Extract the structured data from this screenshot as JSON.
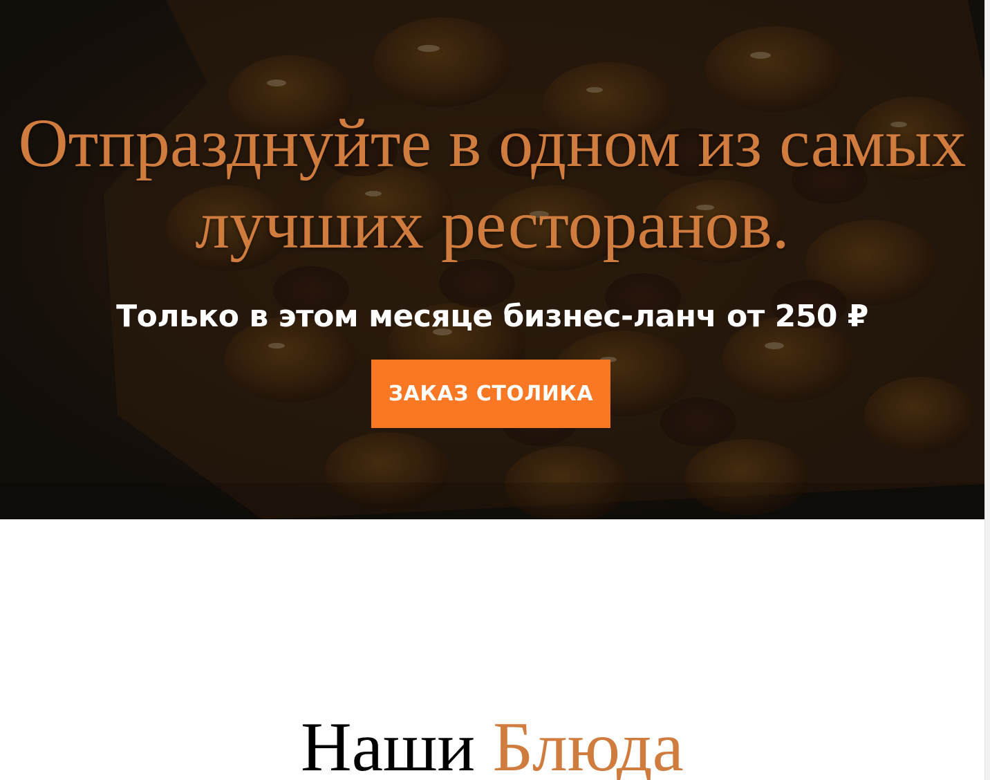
{
  "colors": {
    "accent": "#d07c3f",
    "button": "#fa7723",
    "hero_overlay": "#1a1410",
    "text_light": "#ffffff",
    "text_dark": "#000000"
  },
  "hero": {
    "title": "Отпразднуйте в одном из самых лучших ресторанов.",
    "subtitle": "Только в этом месяце бизнес-ланч от 250 ₽",
    "cta_label": "ЗАКАЗ СТОЛИКА"
  },
  "dishes": {
    "title_part1": "Наши",
    "title_part2": "Блюда"
  }
}
